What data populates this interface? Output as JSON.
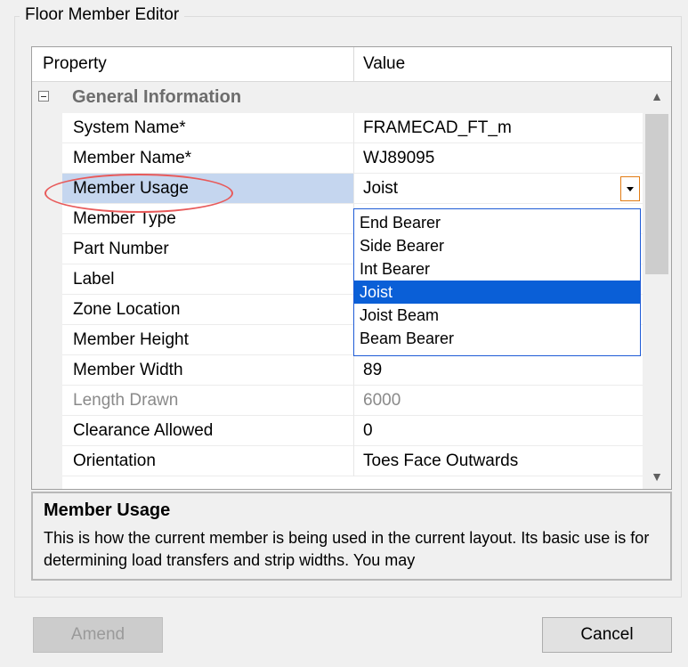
{
  "group_title": "Floor Member Editor",
  "grid": {
    "headers": {
      "property": "Property",
      "value": "Value"
    },
    "category": "General Information",
    "rows": [
      {
        "property": "System Name*",
        "value": "FRAMECAD_FT_m"
      },
      {
        "property": "Member Name*",
        "value": "WJ89095"
      },
      {
        "property": "Member Usage",
        "value": "Joist"
      },
      {
        "property": "Member Type",
        "value": ""
      },
      {
        "property": "Part Number",
        "value": ""
      },
      {
        "property": "Label",
        "value": ""
      },
      {
        "property": "Zone Location",
        "value": ""
      },
      {
        "property": "Member Height",
        "value": ""
      },
      {
        "property": "Member Width",
        "value": "89"
      },
      {
        "property": "Length Drawn",
        "value": "6000"
      },
      {
        "property": "Clearance Allowed",
        "value": "0"
      },
      {
        "property": "Orientation",
        "value": "Toes Face Outwards"
      }
    ],
    "scroll_up_icon": "▲",
    "scroll_down_icon": "▼"
  },
  "dropdown": {
    "options": [
      "End Bearer",
      "Side Bearer",
      "Int Bearer",
      "Joist",
      "Joist Beam",
      "Beam Bearer"
    ],
    "selected": "Joist"
  },
  "help": {
    "title": "Member Usage",
    "text": "This is how the current member is being used in the current layout. Its basic use is for determining load transfers and strip widths. You may"
  },
  "buttons": {
    "amend": "Amend",
    "cancel": "Cancel"
  },
  "colors": {
    "selection": "#0a5fd7",
    "highlight_ellipse": "#e85a5a",
    "dropdown_arrow_border": "#e27c14"
  }
}
